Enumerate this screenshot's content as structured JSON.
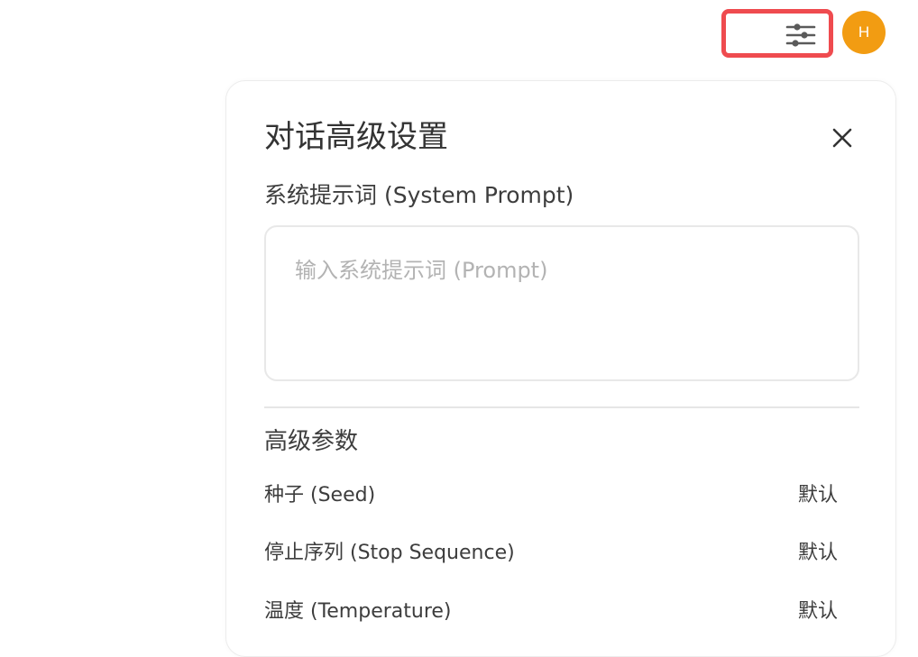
{
  "header": {
    "controls_icon": "sliders-icon",
    "avatar_initial": "H",
    "avatar_color": "#f29c12",
    "highlight_color": "#ef4b4f"
  },
  "panel": {
    "title": "对话高级设置",
    "close_icon": "close-icon",
    "system_prompt": {
      "label": "系统提示词 (System Prompt)",
      "placeholder": "输入系统提示词 (Prompt)",
      "value": ""
    },
    "advanced": {
      "title": "高级参数",
      "params": [
        {
          "name": "种子 (Seed)",
          "value": "默认"
        },
        {
          "name": "停止序列 (Stop Sequence)",
          "value": "默认"
        },
        {
          "name": "温度 (Temperature)",
          "value": "默认"
        }
      ]
    }
  }
}
